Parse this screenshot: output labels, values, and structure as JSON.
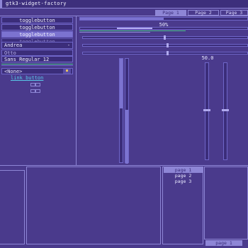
{
  "window": {
    "title": "gtk3-widget-factory"
  },
  "tabs": [
    {
      "label": "Page 1",
      "selected": true
    },
    {
      "label": "Page 2",
      "selected": false
    },
    {
      "label": "Page 3",
      "selected": false
    }
  ],
  "left": {
    "togglebuttons": [
      {
        "label": "togglebutton",
        "state": "normal"
      },
      {
        "label": "togglebutton",
        "state": "normal"
      },
      {
        "label": "togglebutton",
        "state": "active"
      },
      {
        "label": "togglebutton",
        "state": "disabled"
      }
    ],
    "entry_andrea": {
      "value": "Andrea",
      "icon": "minus-icon"
    },
    "entry_otto": {
      "value": "Otto"
    },
    "font_button": {
      "label": "Sans Regular 12"
    },
    "combo": {
      "value": "(None)",
      "icon": "folder-icon"
    },
    "link": {
      "label": "link button"
    }
  },
  "center": {
    "progress_label": "50%",
    "progress_value": 0.5,
    "scale_value_label": "50.0"
  },
  "bottom": {
    "pages": [
      {
        "label": "page 1",
        "selected": true
      },
      {
        "label": "page 2",
        "selected": false
      },
      {
        "label": "page 3",
        "selected": false
      }
    ],
    "bottom_tab": "page 1"
  },
  "colors": {
    "background": "#4a3a8c",
    "accent": "#8e86d6",
    "dark": "#3b2d7a",
    "green": "#49c48a",
    "link": "#58c8e8"
  }
}
